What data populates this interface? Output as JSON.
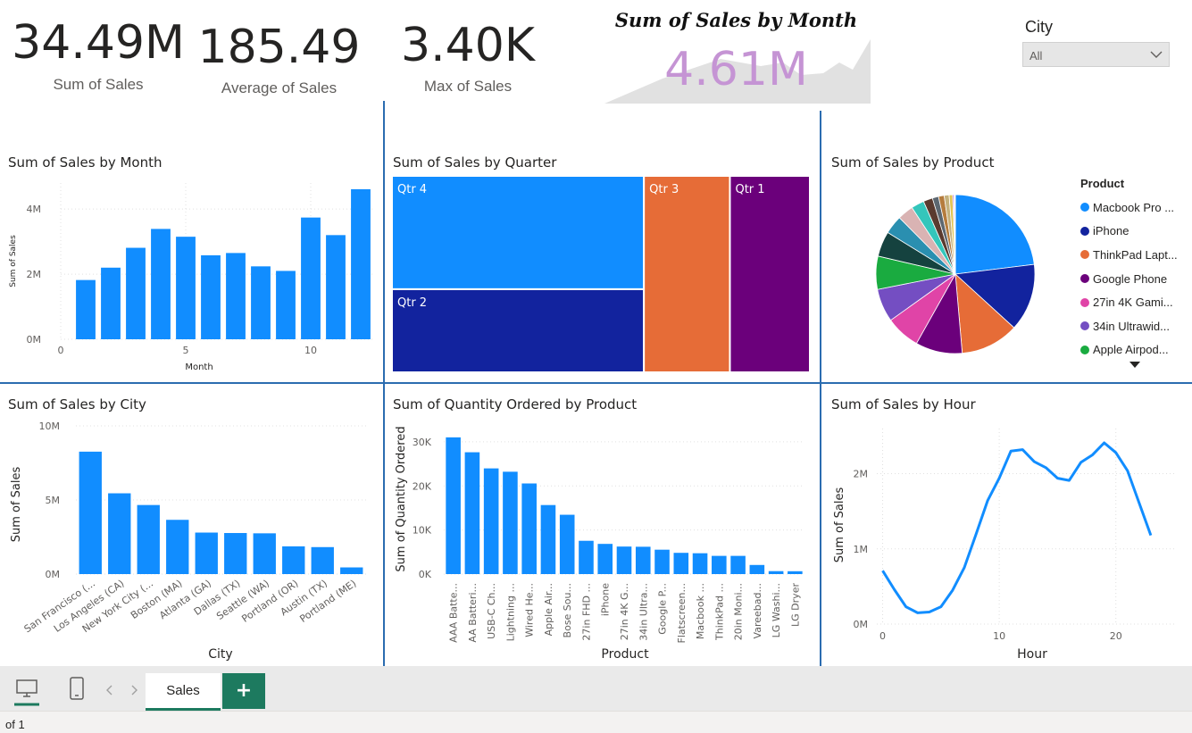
{
  "kpis": [
    {
      "value": "34.49M",
      "label": "Sum of Sales"
    },
    {
      "value": "185.49",
      "label": "Average of Sales"
    },
    {
      "value": "3.40K",
      "label": "Max of Sales"
    }
  ],
  "card_month": {
    "title": "Sum of Sales by Month",
    "value": "4.61M"
  },
  "city_filter": {
    "label": "City",
    "selected": "All"
  },
  "colors": {
    "accent": "#118dff",
    "divider": "#2b6cb0",
    "tab_green": "#1d7a5f"
  },
  "chart_data": [
    {
      "type": "bar",
      "title": "Sum of Sales by Month",
      "xlabel": "Month",
      "ylabel": "Sum of Sales",
      "x": [
        1,
        2,
        3,
        4,
        5,
        6,
        7,
        8,
        9,
        10,
        11,
        12
      ],
      "values": [
        1.82,
        2.2,
        2.81,
        3.39,
        3.15,
        2.58,
        2.65,
        2.24,
        2.1,
        3.74,
        3.2,
        4.61
      ],
      "xticks": [
        "0",
        "5",
        "10"
      ],
      "yticks": [
        "0M",
        "2M",
        "4M"
      ],
      "ylim": [
        0,
        4.8
      ]
    },
    {
      "type": "treemap",
      "title": "Sum of Sales by Quarter",
      "categories": [
        "Qtr 4",
        "Qtr 2",
        "Qtr 3",
        "Qtr 1"
      ],
      "values": [
        12.0,
        8.8,
        7.1,
        6.6
      ],
      "colors": [
        "#118dff",
        "#12239e",
        "#e66c37",
        "#6b007b"
      ]
    },
    {
      "type": "pie",
      "title": "Sum of Sales by Product",
      "legend_title": "Product",
      "categories": [
        "Macbook Pro ...",
        "iPhone",
        "ThinkPad Lapt...",
        "Google Phone",
        "27in 4K Gami...",
        "34in Ultrawid...",
        "Apple Airpod..."
      ],
      "values": [
        8.04,
        4.79,
        4.13,
        3.32,
        2.44,
        2.36,
        2.35,
        1.79,
        1.32,
        1.13,
        0.92,
        0.66,
        0.44,
        0.4,
        0.35,
        0.25,
        0.09,
        0.07,
        0.03
      ],
      "colors": [
        "#118dff",
        "#12239e",
        "#e66c37",
        "#6b007b",
        "#e044a7",
        "#744ec2",
        "#1aab40",
        "#15423f",
        "#2a8fb0",
        "#d9b3b3",
        "#34c6bb",
        "#5a3a2e",
        "#5c6770",
        "#b57c3d",
        "#c4b17d",
        "#e3c450",
        "#9e5ce0",
        "#f2a3c8",
        "#a0c0e8"
      ],
      "legend_position": "right"
    },
    {
      "type": "bar",
      "title": "Sum of Sales by City",
      "xlabel": "City",
      "ylabel": "Sum of Sales",
      "categories": [
        "San Francisco (...",
        "Los Angeles (CA)",
        "New York City (...",
        "Boston (MA)",
        "Atlanta (GA)",
        "Dallas (TX)",
        "Seattle (WA)",
        "Portland (OR)",
        "Austin (TX)",
        "Portland (ME)"
      ],
      "values": [
        8.26,
        5.45,
        4.66,
        3.66,
        2.8,
        2.77,
        2.75,
        1.87,
        1.82,
        0.45
      ],
      "yticks": [
        "0M",
        "5M",
        "10M"
      ],
      "ylim": [
        0,
        10
      ]
    },
    {
      "type": "bar",
      "title": "Sum of Quantity Ordered by Product",
      "xlabel": "Product",
      "ylabel": "Sum of Quantity Ordered",
      "categories": [
        "AAA Batte...",
        "AA Batteri...",
        "USB-C Ch...",
        "Lightning ...",
        "Wired He...",
        "Apple Air...",
        "Bose Sou...",
        "27in FHD ...",
        "iPhone",
        "27in 4K G...",
        "34in Ultra...",
        "Google P...",
        "Flatscreen...",
        "Macbook ...",
        "ThinkPad ...",
        "20in Moni...",
        "Vareebad...",
        "LG Washi...",
        "LG Dryer"
      ],
      "values": [
        31017,
        27635,
        23975,
        23217,
        20557,
        15661,
        13457,
        7550,
        6849,
        6244,
        6199,
        5532,
        4819,
        4728,
        4130,
        4129,
        2068,
        666,
        646
      ],
      "yticks": [
        "0K",
        "10K",
        "20K",
        "30K"
      ],
      "ylim": [
        0,
        32000
      ]
    },
    {
      "type": "line",
      "title": "Sum of Sales by Hour",
      "xlabel": "Hour",
      "ylabel": "Sum of Sales",
      "x": [
        0,
        1,
        2,
        3,
        4,
        5,
        6,
        7,
        8,
        9,
        10,
        11,
        12,
        13,
        14,
        15,
        16,
        17,
        18,
        19,
        20,
        21,
        22,
        23
      ],
      "values": [
        0.71,
        0.46,
        0.23,
        0.15,
        0.16,
        0.23,
        0.45,
        0.75,
        1.19,
        1.64,
        1.94,
        2.3,
        2.32,
        2.16,
        2.08,
        1.94,
        1.91,
        2.15,
        2.25,
        2.41,
        2.28,
        2.04,
        1.61,
        1.18
      ],
      "xticks": [
        "0",
        "10",
        "20"
      ],
      "yticks": [
        "0M",
        "1M",
        "2M"
      ],
      "ylim": [
        0,
        2.6
      ]
    }
  ],
  "bottom_bar": {
    "tab_label": "Sales",
    "add_label": "+",
    "page_info": "of 1"
  }
}
